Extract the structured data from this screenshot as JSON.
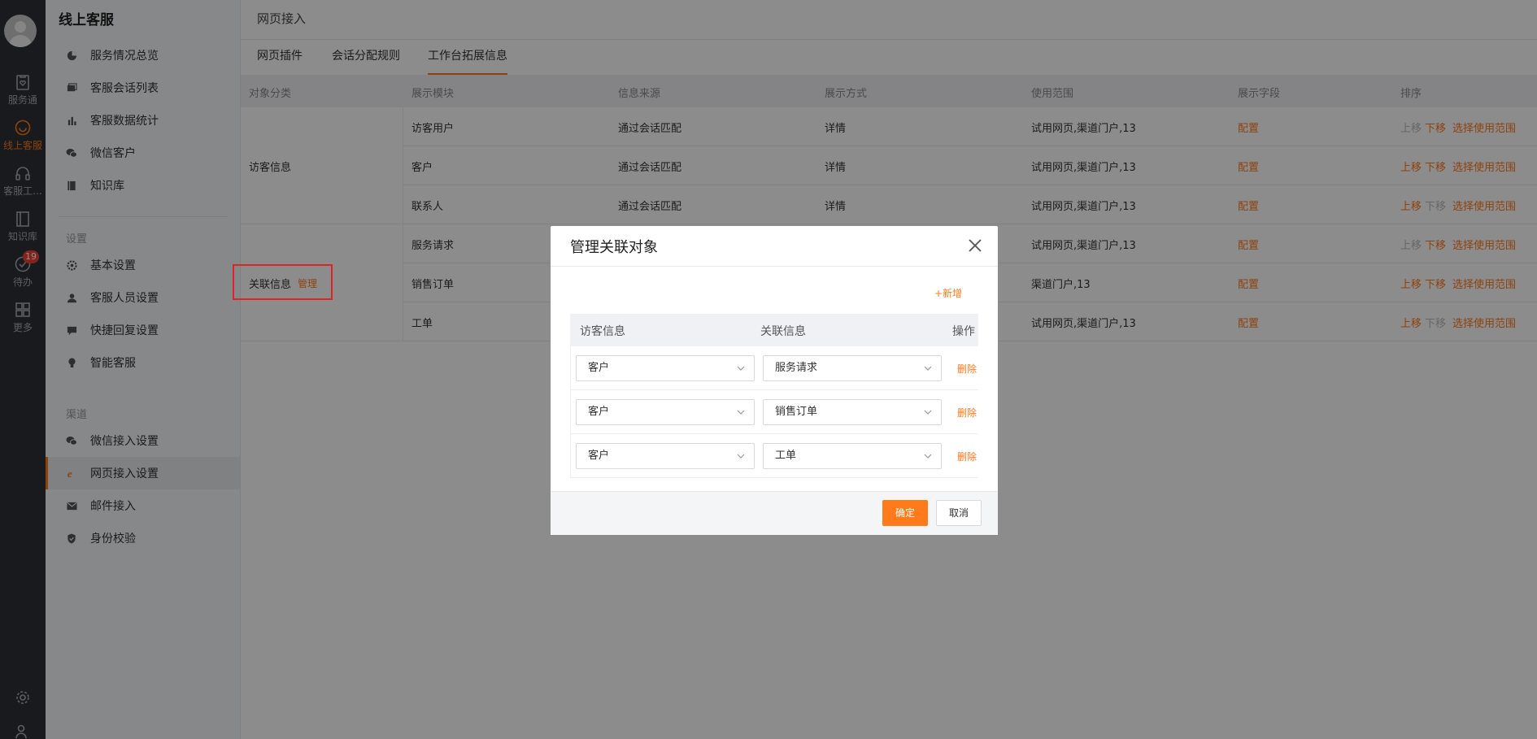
{
  "rail": {
    "items": [
      {
        "label": "服务通",
        "icon": "clipboard-heart-icon"
      },
      {
        "label": "线上客服",
        "icon": "smile-chat-icon"
      },
      {
        "label": "客服工...",
        "icon": "headset-icon"
      },
      {
        "label": "知识库",
        "icon": "book-icon"
      },
      {
        "label": "待办",
        "icon": "check-circle-icon",
        "badge": "19"
      },
      {
        "label": "更多",
        "icon": "grid-icon"
      }
    ],
    "bottom_icons": [
      "gear-icon",
      "user-list-icon"
    ],
    "accent": "#ff7a1a"
  },
  "sidebar": {
    "title": "线上客服",
    "items": [
      {
        "label": "服务情况总览",
        "icon": "pie-chart-icon"
      },
      {
        "label": "客服会话列表",
        "icon": "chat-list-icon"
      },
      {
        "label": "客服数据统计",
        "icon": "bar-chart-icon"
      },
      {
        "label": "微信客户",
        "icon": "wechat-icon"
      },
      {
        "label": "知识库",
        "icon": "book-icon"
      }
    ],
    "settings_group": "设置",
    "settings_items": [
      {
        "label": "基本设置",
        "icon": "gear-icon"
      },
      {
        "label": "客服人员设置",
        "icon": "user-icon"
      },
      {
        "label": "快捷回复设置",
        "icon": "reply-icon"
      },
      {
        "label": "智能客服",
        "icon": "bulb-icon"
      }
    ],
    "channel_group": "渠道",
    "channel_items": [
      {
        "label": "微信接入设置",
        "icon": "wechat-icon"
      },
      {
        "label": "网页接入设置",
        "icon": "ie-icon",
        "active": true
      },
      {
        "label": "邮件接入",
        "icon": "mail-icon"
      },
      {
        "label": "身份校验",
        "icon": "shield-icon"
      }
    ]
  },
  "main": {
    "breadcrumb": "网页接入",
    "tabs": [
      "网页插件",
      "会话分配规则",
      "工作台拓展信息"
    ],
    "active_tab": 2,
    "table": {
      "headers": [
        "对象分类",
        "展示模块",
        "信息来源",
        "展示方式",
        "使用范围",
        "展示字段",
        "排序"
      ],
      "groups": [
        {
          "label": "访客信息"
        },
        {
          "label": "关联信息",
          "manage": "管理"
        }
      ],
      "rows": [
        {
          "module": "访客用户",
          "source": "通过会话匹配",
          "mode": "详情",
          "scope": "试用网页,渠道门户,13",
          "field": "配置",
          "up": "上移",
          "down": "下移",
          "range": "选择使用范围",
          "up_enabled": false,
          "down_enabled": true
        },
        {
          "module": "客户",
          "source": "通过会话匹配",
          "mode": "详情",
          "scope": "试用网页,渠道门户,13",
          "field": "配置",
          "up": "上移",
          "down": "下移",
          "range": "选择使用范围",
          "up_enabled": true,
          "down_enabled": true
        },
        {
          "module": "联系人",
          "source": "通过会话匹配",
          "mode": "详情",
          "scope": "试用网页,渠道门户,13",
          "field": "配置",
          "up": "上移",
          "down": "下移",
          "range": "选择使用范围",
          "up_enabled": true,
          "down_enabled": false
        },
        {
          "module": "服务请求",
          "source": "",
          "mode": "",
          "scope": "试用网页,渠道门户,13",
          "field": "配置",
          "up": "上移",
          "down": "下移",
          "range": "选择使用范围",
          "up_enabled": false,
          "down_enabled": true
        },
        {
          "module": "销售订单",
          "source": "",
          "mode": "",
          "scope": "渠道门户,13",
          "field": "配置",
          "up": "上移",
          "down": "下移",
          "range": "选择使用范围",
          "up_enabled": true,
          "down_enabled": true
        },
        {
          "module": "工单",
          "source": "",
          "mode": "",
          "scope": "试用网页,渠道门户,13",
          "field": "配置",
          "up": "上移",
          "down": "下移",
          "range": "选择使用范围",
          "up_enabled": true,
          "down_enabled": false
        }
      ]
    }
  },
  "modal": {
    "title": "管理关联对象",
    "add_label": "+新增",
    "headers": [
      "访客信息",
      "关联信息",
      "操作"
    ],
    "rows": [
      {
        "visitor": "客户",
        "related": "服务请求",
        "action": "删除"
      },
      {
        "visitor": "客户",
        "related": "销售订单",
        "action": "删除"
      },
      {
        "visitor": "客户",
        "related": "工单",
        "action": "删除"
      }
    ],
    "ok_label": "确定",
    "cancel_label": "取消"
  }
}
